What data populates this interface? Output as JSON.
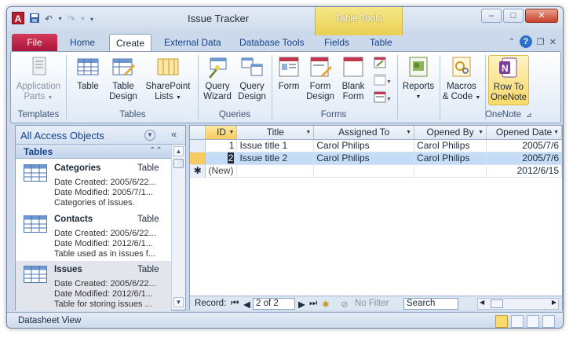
{
  "window": {
    "title": "Issue Tracker",
    "contextual_tab_group": "Table Tools",
    "app_icon_letter": "A",
    "accent_color": "#b5202e"
  },
  "ribbon_tabs": [
    "File",
    "Home",
    "Create",
    "External Data",
    "Database Tools",
    "Fields",
    "Table"
  ],
  "active_tab": "Create",
  "ribbon": {
    "templates": {
      "app_parts_1": "Application",
      "app_parts_2": "Parts",
      "group": "Templates"
    },
    "tables": {
      "table": "Table",
      "design_1": "Table",
      "design_2": "Design",
      "sharepoint_1": "SharePoint",
      "sharepoint_2": "Lists",
      "group": "Tables"
    },
    "queries": {
      "wizard_1": "Query",
      "wizard_2": "Wizard",
      "design_1": "Query",
      "design_2": "Design",
      "group": "Queries"
    },
    "forms": {
      "form": "Form",
      "design_1": "Form",
      "design_2": "Design",
      "blank_1": "Blank",
      "blank_2": "Form",
      "group": "Forms"
    },
    "reports": {
      "label": "Reports"
    },
    "macros": {
      "label_1": "Macros",
      "label_2": "& Code"
    },
    "onenote": {
      "label_1": "Row To",
      "label_2": "OneNote",
      "group": "OneNote"
    }
  },
  "nav": {
    "header": "All Access Objects",
    "group": "Tables",
    "items": [
      {
        "name": "Categories",
        "type": "Table",
        "created": "Date Created: 2005/6/22...",
        "modified": "Date Modified: 2005/7/1...",
        "desc": "Categories of issues."
      },
      {
        "name": "Contacts",
        "type": "Table",
        "created": "Date Created: 2005/6/22...",
        "modified": "Date Modified: 2012/6/1...",
        "desc": "Table used as in issues f..."
      },
      {
        "name": "Issues",
        "type": "Table",
        "created": "Date Created: 2005/6/22...",
        "modified": "Date Modified: 2012/6/1...",
        "desc": "Table for storing issues ..."
      }
    ]
  },
  "grid": {
    "columns": [
      "ID",
      "Title",
      "Assigned To",
      "Opened By",
      "Opened Date"
    ],
    "rows": [
      {
        "id": "1",
        "title": "Issue title 1",
        "assigned": "Carol Philips",
        "opened_by": "Carol Philips",
        "date": "2005/7/6"
      },
      {
        "id": "2",
        "title": "Issue title 2",
        "assigned": "Carol Philips",
        "opened_by": "Carol Philips",
        "date": "2005/7/6"
      }
    ],
    "new_row": {
      "id": "(New)",
      "date": "2012/6/15"
    }
  },
  "record_nav": {
    "label": "Record:",
    "position": "2 of 2",
    "filter": "No Filter",
    "search": "Search"
  },
  "status": {
    "view": "Datasheet View"
  }
}
